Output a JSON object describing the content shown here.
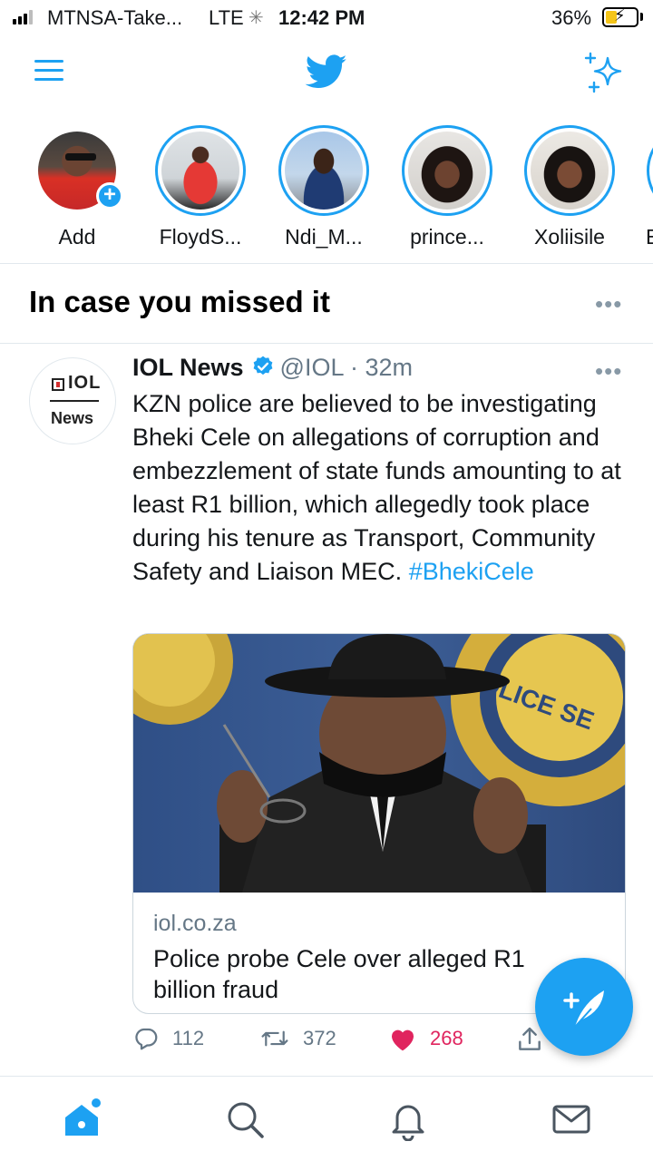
{
  "status_bar": {
    "carrier": "MTNSA-Take...",
    "network": "LTE",
    "time": "12:42 PM",
    "battery_percent": "36%",
    "battery_level": 0.36
  },
  "top_nav": {
    "menu_icon": "hamburger-menu-icon",
    "logo_icon": "twitter-bird-icon",
    "sparkle_icon": "sparkle-icon"
  },
  "fleets": [
    {
      "name": "Add",
      "has_add_badge": true
    },
    {
      "name": "FloydS..."
    },
    {
      "name": "Ndi_M..."
    },
    {
      "name": "prince..."
    },
    {
      "name": "Xoliisile"
    },
    {
      "name": "E"
    }
  ],
  "section": {
    "title": "In case you missed it"
  },
  "tweet": {
    "avatar_logo_top": "IOL",
    "avatar_logo_bottom": "News",
    "name": "IOL News",
    "handle": "@IOL",
    "separator": "·",
    "age": "32m",
    "text": "KZN police are believed to be investigating Bheki Cele on allegations of corruption and embezzlement of state funds amounting to at least R1 billion, which allegedly took place during his tenure as Transport, Community Safety and Liaison MEC.",
    "hashtag": "#BhekiCele",
    "card": {
      "domain": "iol.co.za",
      "title": "Police probe Cele over alleged R1 billion fraud"
    },
    "actions": {
      "replies": "112",
      "retweets": "372",
      "likes": "268"
    }
  },
  "colors": {
    "accent": "#1da1f2",
    "like": "#e0245e",
    "muted": "#657786"
  },
  "bottom_nav": [
    "home-icon",
    "search-icon",
    "notifications-icon",
    "messages-icon"
  ]
}
